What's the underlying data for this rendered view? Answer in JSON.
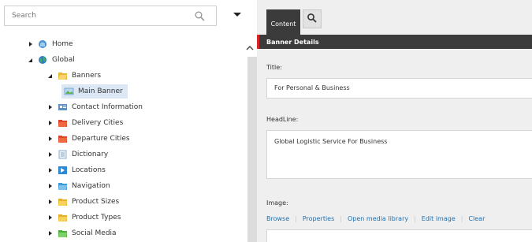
{
  "search": {
    "placeholder": "Search"
  },
  "tree": {
    "items": [
      {
        "label": "Home",
        "icon": "globe-home-icon"
      },
      {
        "label": "Global",
        "icon": "globe-icon"
      },
      {
        "label": "Banners",
        "icon": "folder-open-icon"
      },
      {
        "label": "Main Banner",
        "icon": "image-icon"
      },
      {
        "label": "Contact Information",
        "icon": "contact-card-icon"
      },
      {
        "label": "Delivery Cities",
        "icon": "red-folder-icon"
      },
      {
        "label": "Departure Cities",
        "icon": "red-folder-icon"
      },
      {
        "label": "Dictionary",
        "icon": "document-icon"
      },
      {
        "label": "Locations",
        "icon": "location-icon"
      },
      {
        "label": "Navigation",
        "icon": "navigation-icon"
      },
      {
        "label": "Product Sizes",
        "icon": "yellow-folder-icon"
      },
      {
        "label": "Product Types",
        "icon": "yellow-folder-icon"
      },
      {
        "label": "Social Media",
        "icon": "green-folder-icon"
      }
    ]
  },
  "editor": {
    "tab_content": "Content",
    "section_title": "Banner Details",
    "title_label": "Title:",
    "title_value": "For Personal & Business",
    "headline_label": "HeadLine:",
    "headline_value": "Global Logistic Service For Business",
    "image_label": "Image:",
    "image_actions": [
      "Browse",
      "Properties",
      "Open media library",
      "Edit image",
      "Clear"
    ]
  },
  "colors": {
    "accent": "#d6282b",
    "link": "#1f6fae",
    "header_dark": "#3b3b3b",
    "selected": "#dbe7f4"
  }
}
